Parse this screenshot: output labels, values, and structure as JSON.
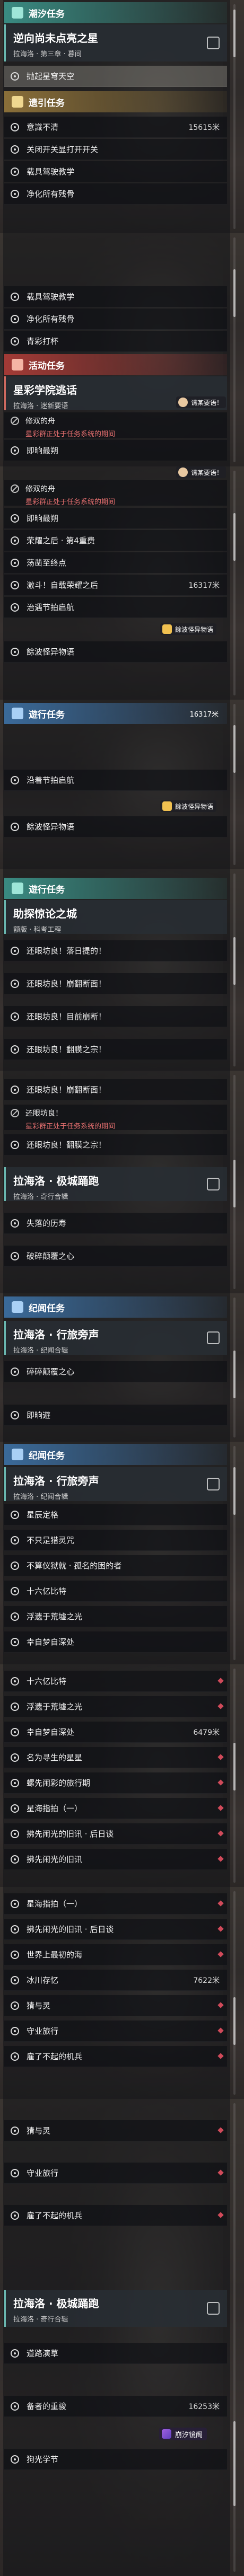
{
  "screens": [
    {
      "header": {
        "label": "潮汐任务"
      },
      "quest": {
        "title": "逆向尚未点亮之星",
        "subtitle": "拉海洛 · 第三章 · 暮间"
      },
      "rows": [
        {
          "text": "抛起星穹天空",
          "selected": true
        },
        {
          "text": "遗引任务",
          "header": true
        },
        {
          "text": "意識不清",
          "num": "15615米"
        },
        {
          "text": "关闭开关显打开开关"
        },
        {
          "text": "载具驾驶教学"
        },
        {
          "text": "净化所有残骨"
        }
      ]
    },
    {
      "rows": [
        {
          "text": "载具驾驶教学"
        },
        {
          "text": "净化所有残骨"
        },
        {
          "text": "青彩打杯"
        }
      ],
      "header": {
        "label": "活动任务"
      },
      "quest": {
        "title": "星彩学院逃话",
        "subtitle": "拉海洛 · 迷新要语"
      },
      "warn_row": {
        "title": "修双的舟",
        "warn": "星彩群正处于任务系统的期间"
      },
      "rows2": [
        {
          "text": "即晌最朔"
        }
      ],
      "toast": "请某要语！"
    },
    {
      "warn_row": {
        "title": "修双的舟",
        "warn": "星彩群正处于任务系统的期间"
      },
      "rows": [
        {
          "text": "即晌最朔"
        },
        {
          "text": "荣耀之后 · 第4重费"
        },
        {
          "text": "荡凿至终点"
        },
        {
          "text": "激斗！自载荣耀之后",
          "num": "16317米"
        },
        {
          "text": "治遇节拍启航"
        },
        {
          "text": "餘波怪异物语"
        }
      ],
      "toast": "请某要语！",
      "toast2": "餘波怪异物语"
    },
    {
      "header": {
        "label": "遊行任务"
      },
      "rows": [
        {
          "text": "沿着节拍启航"
        },
        {
          "text": "餘波怪异物语"
        }
      ],
      "num": "16317米",
      "toast": "餘波怪异物语"
    },
    {
      "header": {
        "label": "遊行任务"
      },
      "quest": {
        "title": "助探惊论之城",
        "subtitle": "额版 · 科考工程"
      },
      "rows": [
        {
          "text": "还眼坊良！落日提的！"
        },
        {
          "text": "还眼坊良！崩翻断面！"
        },
        {
          "text": "还眼坊良！目前崩断！"
        },
        {
          "text": "还眼坊良！翻膜之宗！"
        }
      ]
    },
    {
      "rows": [
        {
          "text": "还眼坊良！崩翻断面！"
        }
      ],
      "warn_row": {
        "title": "还眼坊良！",
        "warn": "星彩群正处于任务系统的期间"
      },
      "rows2": [
        {
          "text": "还眼坊良！翻膜之宗！"
        }
      ],
      "quest": {
        "title": "拉海洛 · 极城踊跑",
        "subtitle": "拉海洛 · 奇行合辑"
      },
      "rows3": [
        {
          "text": "失落的历寿"
        },
        {
          "text": "破碎颠覆之心"
        }
      ]
    },
    {
      "header": {
        "label": "纪闻任务"
      },
      "quest": {
        "title": "拉海洛 · 行旅旁声",
        "subtitle": "拉海洛 · 纪闻合辑"
      },
      "rows": [
        {
          "text": "碎碎颠覆之心"
        },
        {
          "text": "即晌遊"
        }
      ]
    },
    {
      "header": {
        "label": "纪闻任务"
      },
      "quest": {
        "title": "拉海洛 · 行旅旁声",
        "subtitle": "拉海洛 · 纪闻合辑"
      },
      "rows": [
        {
          "text": "星辰定格"
        },
        {
          "text": "不只是猎灵咒"
        },
        {
          "text": "不算仪狱就 · 孤名的困的者"
        },
        {
          "text": "十六亿比特"
        },
        {
          "text": "浮遗于荒墟之光"
        },
        {
          "text": "幸自梦自深处"
        }
      ]
    },
    {
      "rows": [
        {
          "text": "十六亿比特"
        },
        {
          "text": "浮遗于荒墟之光"
        },
        {
          "text": "幸自梦自深处",
          "num": "6479米"
        },
        {
          "text": "名为寻生的星星"
        },
        {
          "text": "螺先闹彩的旅行期"
        },
        {
          "text": "星海指拍（一）"
        },
        {
          "text": "拂先闹光的旧讯 · 后日谈"
        },
        {
          "text": "拂先闹光的旧讯"
        }
      ]
    },
    {
      "rows": [
        {
          "text": "星海指拍（一）"
        },
        {
          "text": "拂先闹光的旧讯 · 后日谈"
        },
        {
          "text": "世界上最初的海"
        },
        {
          "text": "冰川存忆",
          "num": "7622米"
        },
        {
          "text": "猜与灵"
        },
        {
          "text": "守业旅行"
        },
        {
          "text": "雇了不起的机兵"
        }
      ]
    },
    {
      "rows": [
        {
          "text": "猜与灵"
        },
        {
          "text": "守业旅行"
        },
        {
          "text": "雇了不起的机兵"
        }
      ],
      "quest": {
        "title": "拉海洛 · 极城踊跑",
        "subtitle": "拉海洛 · 奇行合辑"
      },
      "rows2": [
        {
          "text": "道路演草"
        },
        {
          "text": "备者的重骏",
          "num": "16253米"
        },
        {
          "text": "狗光学节"
        }
      ],
      "logo": "崩汐镜阁"
    }
  ]
}
